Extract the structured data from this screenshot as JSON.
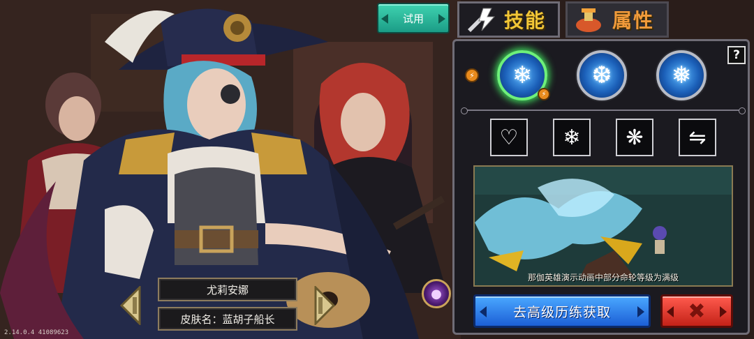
{
  "hero": {
    "name": "尤莉安娜",
    "skin_label": "皮肤名：蓝胡子船长"
  },
  "version": "2.14.0.4 41089623",
  "trial_button": "试用",
  "tabs": [
    {
      "label": "技能",
      "icon": "sword-lightning-icon",
      "selected": true
    },
    {
      "label": "属性",
      "icon": "potion-flask-icon",
      "selected": false
    }
  ],
  "help_label": "?",
  "skills": [
    {
      "icon": "snowflake-burst-icon",
      "active": true
    },
    {
      "icon": "ice-shards-icon",
      "active": false
    },
    {
      "icon": "frost-blade-icon",
      "active": false
    }
  ],
  "runes": [
    {
      "icon": "heart-snowflake-icon"
    },
    {
      "icon": "snowflake-icon"
    },
    {
      "icon": "ice-crystals-icon"
    },
    {
      "icon": "ice-spears-icon"
    }
  ],
  "preview_caption": "那伽英雄演示动画中部分命轮等级为满级",
  "go_button": "去高级历练获取",
  "colors": {
    "skills_tab": "#f2c636",
    "attrs_tab": "#f09a3a",
    "go_button": "#2a7ef0",
    "close_button": "#e8382c",
    "active_skill_ring": "#6ef07a"
  }
}
